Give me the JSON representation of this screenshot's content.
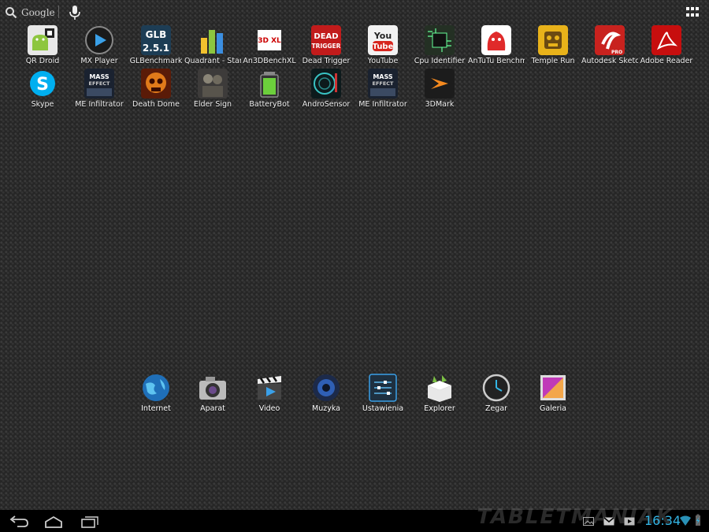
{
  "top_bar": {
    "search_label": "Google",
    "voice_icon": "microphone-icon",
    "all_apps_icon": "grid-icon"
  },
  "apps": [
    {
      "label": "QR Droid",
      "icon": "qr-droid-icon"
    },
    {
      "label": "MX Player",
      "icon": "mx-player-icon"
    },
    {
      "label": "GLBenchmark",
      "icon": "glbenchmark-icon",
      "icon_text": "GLB 2.5.1"
    },
    {
      "label": "Quadrant - Standard",
      "icon": "quadrant-icon"
    },
    {
      "label": "An3DBenchXL",
      "icon": "an3dbench-icon"
    },
    {
      "label": "Dead Trigger",
      "icon": "dead-trigger-icon",
      "icon_text": "DEAD TRIGGER"
    },
    {
      "label": "YouTube",
      "icon": "youtube-icon",
      "icon_text": "You Tube"
    },
    {
      "label": "Cpu Identifier",
      "icon": "cpu-identifier-icon"
    },
    {
      "label": "AnTuTu Benchmark",
      "icon": "antutu-icon"
    },
    {
      "label": "Temple Run",
      "icon": "temple-run-icon"
    },
    {
      "label": "Autodesk SketchBook",
      "icon": "autodesk-sketchbook-icon",
      "icon_text": "PRO"
    },
    {
      "label": "Adobe Reader",
      "icon": "adobe-reader-icon"
    },
    {
      "label": "Skype",
      "icon": "skype-icon"
    },
    {
      "label": "ME Infiltrator",
      "icon": "mass-effect-icon",
      "icon_text": "MASS EFFECT"
    },
    {
      "label": "Death Dome",
      "icon": "death-dome-icon"
    },
    {
      "label": "Elder Sign",
      "icon": "elder-sign-icon"
    },
    {
      "label": "BatteryBot",
      "icon": "batterybot-icon"
    },
    {
      "label": "AndroSensor",
      "icon": "androsensor-icon"
    },
    {
      "label": "ME Infiltrator",
      "icon": "mass-effect-icon",
      "icon_text": "MASS EFFECT"
    },
    {
      "label": "3DMark",
      "icon": "3dmark-icon"
    }
  ],
  "dock": [
    {
      "label": "Internet",
      "icon": "globe-icon"
    },
    {
      "label": "Aparat",
      "icon": "camera-icon"
    },
    {
      "label": "Video",
      "icon": "video-clapper-icon"
    },
    {
      "label": "Muzyka",
      "icon": "speaker-icon"
    },
    {
      "label": "Ustawienia",
      "icon": "settings-sliders-icon"
    },
    {
      "label": "Explorer",
      "icon": "explorer-box-icon"
    },
    {
      "label": "Zegar",
      "icon": "clock-icon"
    },
    {
      "label": "Galeria",
      "icon": "gallery-icon"
    }
  ],
  "nav_bar": {
    "back_icon": "back-icon",
    "home_icon": "home-icon",
    "recents_icon": "recent-apps-icon",
    "watermark": "TABLETMANIAK",
    "time": "16:34",
    "notifications": [
      "gallery-notification-icon",
      "gmail-notification-icon",
      "media-notification-icon"
    ]
  },
  "colors": {
    "accent_clock": "#33b5e5",
    "background": "#262626"
  }
}
